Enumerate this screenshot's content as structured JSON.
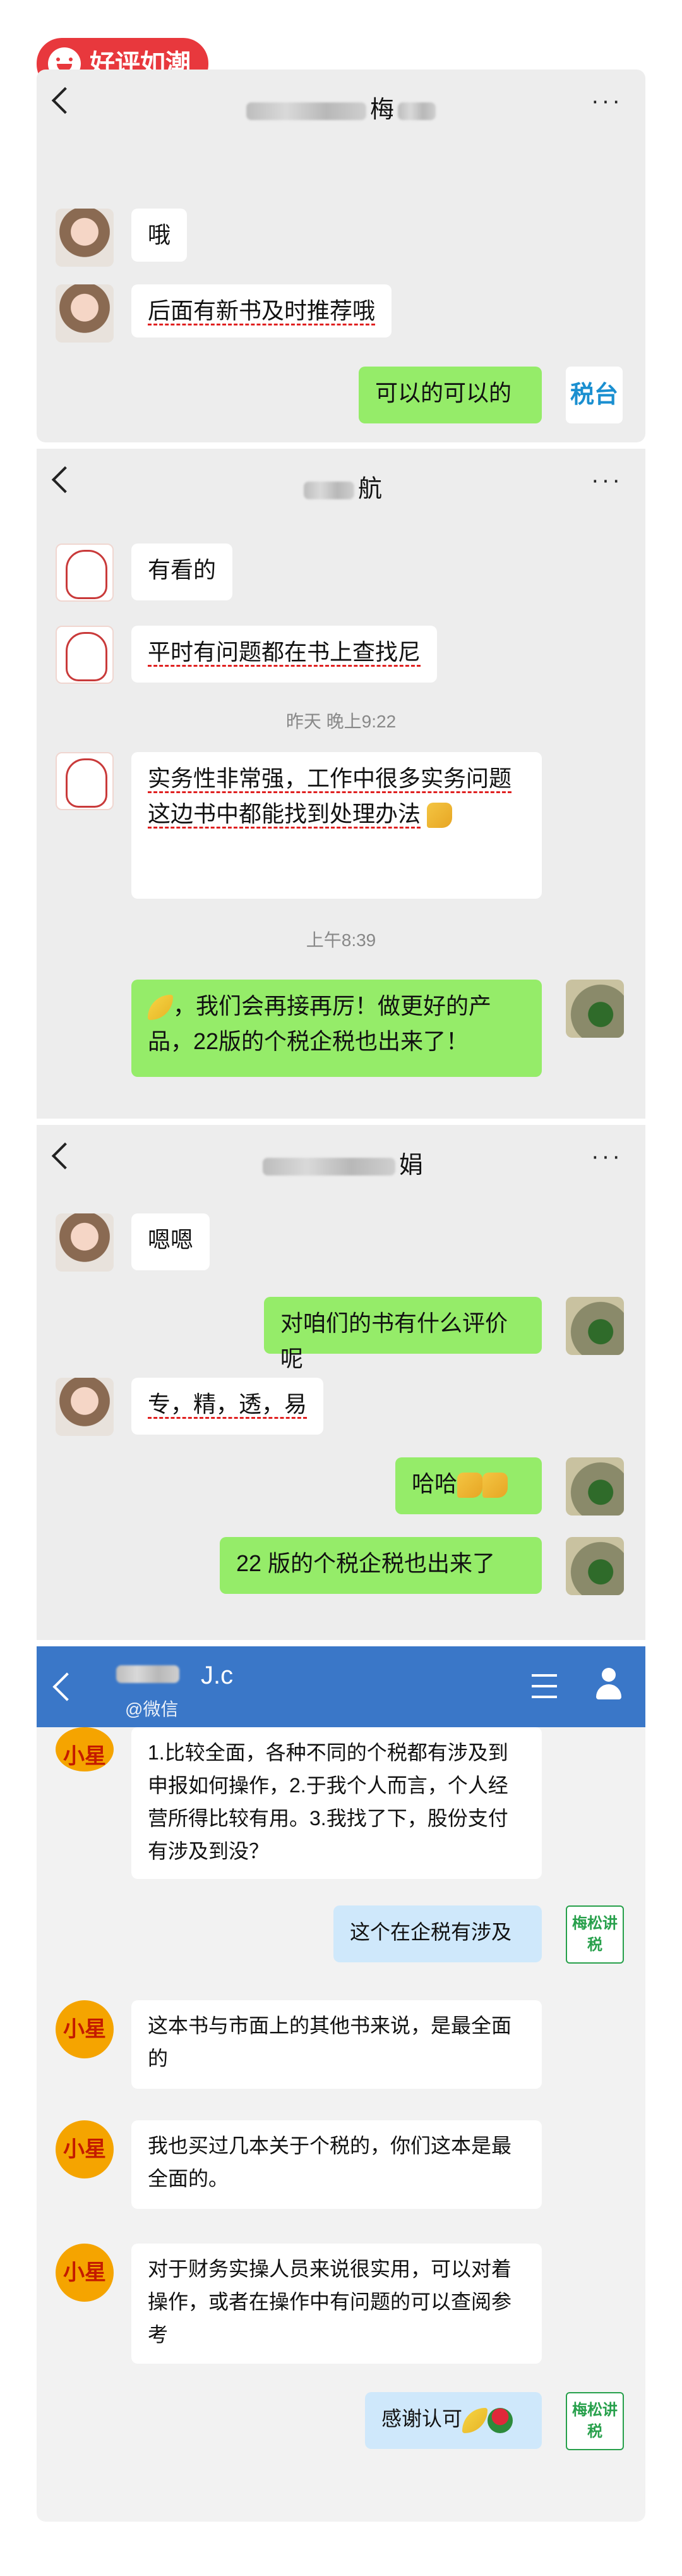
{
  "badge": {
    "label": "好评如潮"
  },
  "chat1": {
    "title": "梅",
    "messages": [
      {
        "text": "哦"
      },
      {
        "text": "后面有新书及时推荐哦"
      },
      {
        "text": "可以的可以的"
      }
    ],
    "tax_label": "税台"
  },
  "chat2": {
    "title": "航",
    "messages": [
      {
        "text": "有看的"
      },
      {
        "text": "平时有问题都在书上查找尼"
      },
      {
        "text": "实务性非常强，工作中很多实务问题这边书中都能找到处理办法"
      },
      {
        "text": "，我们会再接再厉！做更好的产品，22版的个税企税也出来了！"
      }
    ],
    "time1": "昨天 晚上9:22",
    "time2": "上午8:39"
  },
  "chat3": {
    "title": "娟",
    "messages": [
      {
        "text": "嗯嗯"
      },
      {
        "text": "对咱们的书有什么评价呢"
      },
      {
        "text": "专，精，透，易"
      },
      {
        "text": "哈哈"
      },
      {
        "text": "22 版的个税企税也出来了"
      }
    ]
  },
  "chat4": {
    "name": "J.c",
    "sub": "@微信",
    "stamp": "梅松讲税",
    "avatar_label": "小星",
    "messages": [
      {
        "text": "1.比较全面，各种不同的个税都有涉及到申报如何操作，2.于我个人而言，个人经营所得比较有用。3.我找了下，股份支付有涉及到没？"
      },
      {
        "text": "这个在企税有涉及"
      },
      {
        "text": "这本书与市面上的其他书来说，是最全面的"
      },
      {
        "text": "我也买过几本关于个税的，你们这本是最全面的。"
      },
      {
        "text": "对于财务实操人员来说很实用，可以对着操作，或者在操作中有问题的可以查阅参考"
      },
      {
        "text": "感谢认可"
      }
    ]
  },
  "icons": {
    "back": "chevron-left-icon",
    "more": "more-dots-icon",
    "thumbs_up": "thumbs-up-emoji",
    "handshake": "handshake-emoji",
    "rose": "rose-emoji"
  },
  "colors": {
    "badge": "#e8383d",
    "wechat_green": "#95ec69",
    "qq_blue": "#3a77c8",
    "underline_red": "#e02020"
  }
}
